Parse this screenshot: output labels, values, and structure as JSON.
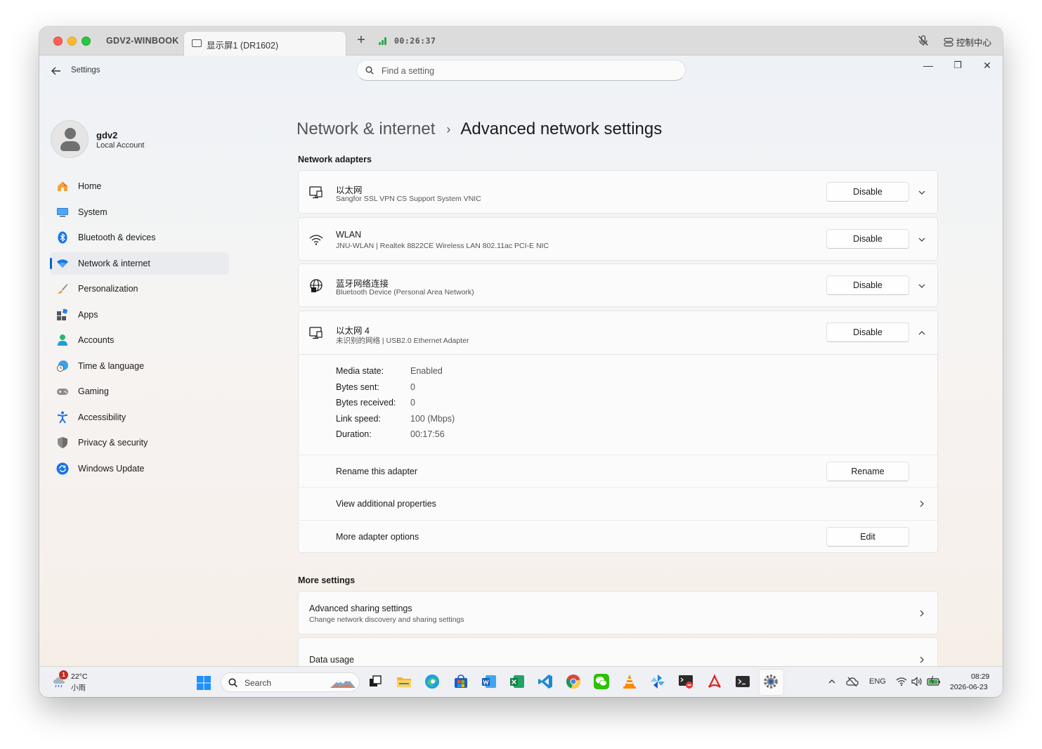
{
  "mac": {
    "host": "GDV2-WINBOOK",
    "tab_label": "显示屏1 (DR1602)",
    "plus": "+",
    "timer": "00:26:37",
    "control_center": "控制中心"
  },
  "window": {
    "app_title": "Settings",
    "search_placeholder": "Find a setting",
    "minimize": "—",
    "restore": "❐",
    "close": "✕"
  },
  "user": {
    "name": "gdv2",
    "account_type": "Local Account"
  },
  "nav": [
    {
      "label": "Home",
      "icon": "home-icon"
    },
    {
      "label": "System",
      "icon": "system-icon"
    },
    {
      "label": "Bluetooth & devices",
      "icon": "bluetooth-icon"
    },
    {
      "label": "Network & internet",
      "icon": "wifi-icon",
      "active": true
    },
    {
      "label": "Personalization",
      "icon": "brush-icon"
    },
    {
      "label": "Apps",
      "icon": "apps-icon"
    },
    {
      "label": "Accounts",
      "icon": "person-icon"
    },
    {
      "label": "Time & language",
      "icon": "clock-globe-icon"
    },
    {
      "label": "Gaming",
      "icon": "gamepad-icon"
    },
    {
      "label": "Accessibility",
      "icon": "accessibility-icon"
    },
    {
      "label": "Privacy & security",
      "icon": "shield-icon"
    },
    {
      "label": "Windows Update",
      "icon": "update-icon"
    }
  ],
  "breadcrumb": {
    "parent": "Network & internet",
    "separator": "›",
    "current": "Advanced network settings"
  },
  "network_adapters": {
    "title": "Network adapters",
    "adapters": [
      {
        "name": "以太网",
        "description": "Sangfor SSL VPN CS Support System VNIC",
        "button": "Disable",
        "icon": "ethernet-icon"
      },
      {
        "name": "WLAN",
        "description": "JNU-WLAN | Realtek 8822CE Wireless LAN 802.11ac PCI-E NIC",
        "button": "Disable",
        "icon": "wifi-icon"
      },
      {
        "name": "蓝牙网络连接",
        "description": "Bluetooth Device (Personal Area Network)",
        "button": "Disable",
        "icon": "globe-network-icon"
      }
    ],
    "expanded": {
      "name": "以太网 4",
      "description": "未识别的网络 | USB2.0 Ethernet Adapter",
      "button": "Disable",
      "icon": "ethernet-icon",
      "stats": [
        {
          "label": "Media state:",
          "value": "Enabled"
        },
        {
          "label": "Bytes sent:",
          "value": "0"
        },
        {
          "label": "Bytes received:",
          "value": "0"
        },
        {
          "label": "Link speed:",
          "value": "100 (Mbps)"
        },
        {
          "label": "Duration:",
          "value": "00:17:56"
        }
      ],
      "rename_label": "Rename this adapter",
      "rename_button": "Rename",
      "view_props_label": "View additional properties",
      "more_options_label": "More adapter options",
      "edit_button": "Edit"
    }
  },
  "more_settings": {
    "title": "More settings",
    "items": [
      {
        "title": "Advanced sharing settings",
        "description": "Change network discovery and sharing settings"
      },
      {
        "title": "Data usage"
      }
    ]
  },
  "taskbar": {
    "weather_badge": "1",
    "temperature": "22°C",
    "weather_desc": "小雨",
    "search_label": "Search",
    "language": "ENG",
    "time": "08:29",
    "date": "2026-06-23"
  }
}
